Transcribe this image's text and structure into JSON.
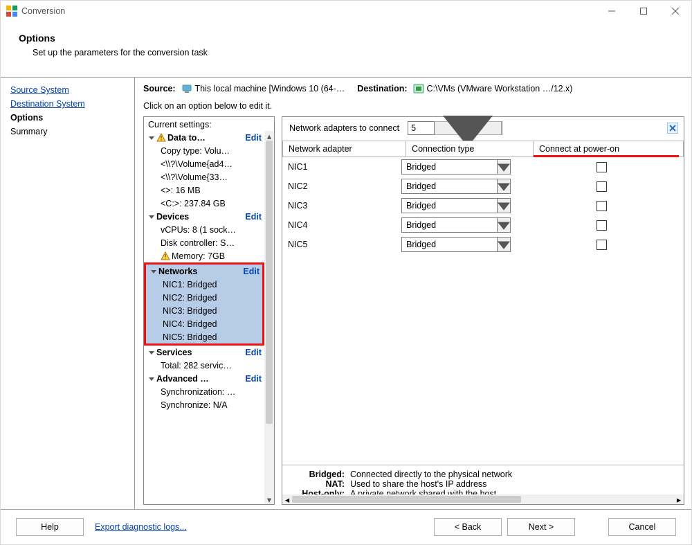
{
  "window": {
    "title": "Conversion"
  },
  "header": {
    "title": "Options",
    "subtitle": "Set up the parameters for the conversion task"
  },
  "sidebar": {
    "source_system": "Source System",
    "destination_system": "Destination System",
    "options": "Options",
    "summary": "Summary"
  },
  "info": {
    "source_label": "Source:",
    "source_value": "This local machine [Windows 10 (64-…",
    "destination_label": "Destination:",
    "destination_value": "C:\\VMs (VMware Workstation …/12.x)"
  },
  "hint": "Click on an option below to edit it.",
  "tree": {
    "title": "Current settings:",
    "edit": "Edit",
    "data_to_copy": {
      "label": "Data to…",
      "copy_type": "Copy type: Volu…",
      "vol1": "<\\\\?\\Volume{ad4…",
      "vol2": "<\\\\?\\Volume{33…",
      "size1": "<>: 16 MB",
      "size2": "<C:>: 237.84 GB"
    },
    "devices": {
      "label": "Devices",
      "vcpus": "vCPUs: 8 (1 sock…",
      "disk": "Disk controller: S…",
      "memory": "Memory: 7GB"
    },
    "networks": {
      "label": "Networks",
      "nic1": "NIC1: Bridged",
      "nic2": "NIC2: Bridged",
      "nic3": "NIC3: Bridged",
      "nic4": "NIC4: Bridged",
      "nic5": "NIC5: Bridged"
    },
    "services": {
      "label": "Services",
      "total": "Total: 282 servic…"
    },
    "advanced": {
      "label": "Advanced …",
      "sync1": "Synchronization: …",
      "sync2": "Synchronize: N/A"
    }
  },
  "detail": {
    "adapters_label": "Network adapters to connect",
    "adapters_count": "5",
    "headers": {
      "a": "Network adapter",
      "b": "Connection type",
      "c": "Connect at power-on"
    },
    "rows": [
      {
        "name": "NIC1",
        "type": "Bridged"
      },
      {
        "name": "NIC2",
        "type": "Bridged"
      },
      {
        "name": "NIC3",
        "type": "Bridged"
      },
      {
        "name": "NIC4",
        "type": "Bridged"
      },
      {
        "name": "NIC5",
        "type": "Bridged"
      }
    ],
    "desc": {
      "bridged_k": "Bridged:",
      "bridged_v": "Connected directly to the physical network",
      "nat_k": "NAT:",
      "nat_v": "Used to share the host's IP address",
      "host_k": "Host-only:",
      "host_v": "A private network shared with the host"
    }
  },
  "footer": {
    "help": "Help",
    "export": "Export diagnostic logs...",
    "back": "< Back",
    "next": "Next >",
    "cancel": "Cancel"
  }
}
